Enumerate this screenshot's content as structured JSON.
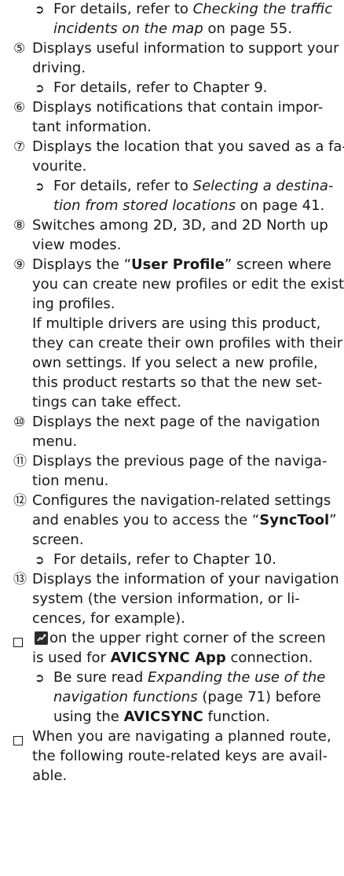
{
  "glyphs": {
    "arrow": "➲",
    "n5": "⑤",
    "n6": "⑥",
    "n7": "⑦",
    "n8": "⑧",
    "n9": "⑨",
    "n10": "⑩",
    "n11": "⑪",
    "n12": "⑫",
    "n13": "⑬"
  },
  "l01": {
    "a": "For details, refer to ",
    "b": "Checking the traffic"
  },
  "l02": {
    "a": "incidents on the map",
    "b": " on page 55."
  },
  "l03": "Displays useful information to support your",
  "l04": "driving.",
  "l05": "For details, refer to Chapter 9.",
  "l06": "Displays notifications that contain impor-",
  "l07": "tant information.",
  "l08": "Displays the location that you saved as a fa-",
  "l09": "vourite.",
  "l10": {
    "a": "For details, refer to ",
    "b": "Selecting a destina-"
  },
  "l11": {
    "a": "tion from stored locations",
    "b": " on page 41."
  },
  "l12": "Switches among 2D, 3D, and 2D North up",
  "l13": "view modes.",
  "l14": {
    "a": "Displays the “",
    "b": "User Profile",
    "c": "” screen where"
  },
  "l15": "you can create new profiles or edit the exist-",
  "l16": "ing profiles.",
  "l17": "If multiple drivers are using this product,",
  "l18": "they can create their own profiles with their",
  "l19": "own settings. If you select a new profile,",
  "l20": "this product restarts so that the new set-",
  "l21": "tings can take effect.",
  "l22": "Displays the next page of the navigation",
  "l23": "menu.",
  "l24": "Displays the previous page of the naviga-",
  "l25": "tion menu.",
  "l26": "Configures the navigation-related settings",
  "l27": {
    "a": "and enables you to access the “",
    "b": "SyncTool",
    "c": "”"
  },
  "l28": "screen.",
  "l29": "For details, refer to Chapter 10.",
  "l30": "Displays the information of your navigation",
  "l31": "system (the version information, or li-",
  "l32": "cences, for example).",
  "l33": " on the upper right corner of the screen",
  "l34": {
    "a": "is used for ",
    "b": "AVICSYNC App",
    "c": " connection."
  },
  "l35": {
    "a": "Be sure read ",
    "b": "Expanding the use of the"
  },
  "l36": {
    "a": "navigation functions",
    "b": " (page 71) before"
  },
  "l37": {
    "a": "using the ",
    "b": "AVICSYNC",
    "c": " function."
  },
  "l38": "When you are navigating a planned route,",
  "l39": "the following route-related keys are avail-",
  "l40": "able."
}
